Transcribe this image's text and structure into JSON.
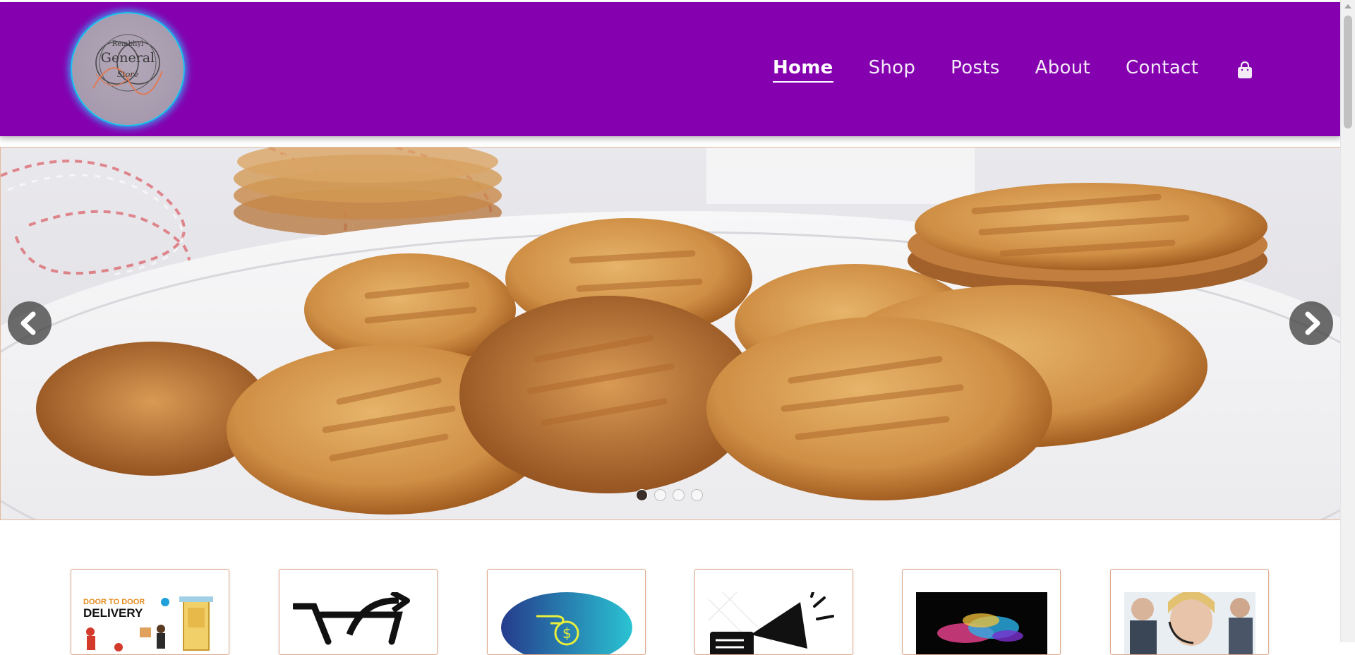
{
  "header": {
    "logo": {
      "line1": "Rembhyl",
      "line2": "General",
      "line3": "Store"
    },
    "nav": [
      {
        "label": "Home",
        "active": true
      },
      {
        "label": "Shop",
        "active": false
      },
      {
        "label": "Posts",
        "active": false
      },
      {
        "label": "About",
        "active": false
      },
      {
        "label": "Contact",
        "active": false
      }
    ],
    "cart_icon": "shopping-bag-icon",
    "colors": {
      "header_bg": "#8501b0",
      "logo_glow": "#19c4ef"
    }
  },
  "carousel": {
    "slide_count": 4,
    "active_slide": 1,
    "slide_image": "cookies-on-plate",
    "prev_icon": "chevron-left-icon",
    "next_icon": "chevron-right-icon"
  },
  "cards": [
    {
      "image": "door-to-door-delivery",
      "text1": "DOOR TO DOOR",
      "text2": "DELIVERY"
    },
    {
      "image": "shopping-cart-return"
    },
    {
      "image": "money-hand"
    },
    {
      "image": "megaphone-news"
    },
    {
      "image": "color-powder-splash"
    },
    {
      "image": "customer-support"
    }
  ]
}
